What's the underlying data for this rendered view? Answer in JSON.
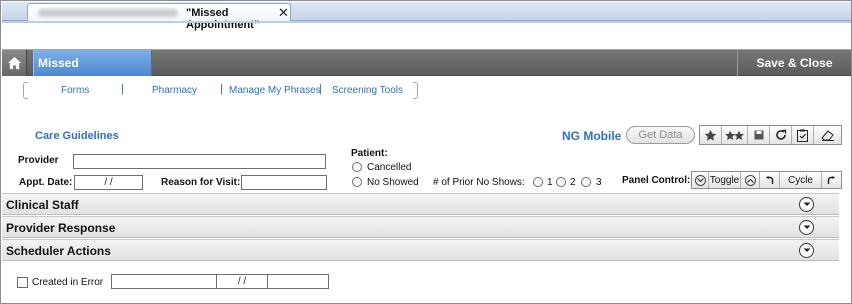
{
  "tab": {
    "title": "\"Missed Appointment\"",
    "close_glyph": "✕"
  },
  "header": {
    "home_icon": "home-icon",
    "form_title": "Missed Appointment",
    "save_close_label": "Save & Close"
  },
  "nav": {
    "links": [
      "Forms",
      "Pharmacy",
      "Manage My Phrases",
      "Screening Tools"
    ],
    "separator": "|"
  },
  "care_guidelines_label": "Care Guidelines",
  "ng_mobile": {
    "label": "NG Mobile",
    "button_label": "Get Data"
  },
  "toolbar_icons": [
    "star-icon",
    "stars-icon",
    "save-icon",
    "refresh-icon",
    "clipboard-check-icon",
    "eraser-icon"
  ],
  "form": {
    "provider_label": "Provider",
    "provider_value": "",
    "appt_date_label": "Appt. Date:",
    "appt_date_value": "/ /",
    "reason_label": "Reason for Visit:",
    "reason_value": "",
    "patient_label": "Patient:",
    "patient_options": [
      "Cancelled",
      "No Showed"
    ],
    "prior_no_shows_label": "# of Prior No Shows:",
    "prior_no_shows_options": [
      "1",
      "2",
      "3"
    ]
  },
  "panel_control": {
    "label": "Panel Control:",
    "toggle_label": "Toggle",
    "cycle_label": "Cycle"
  },
  "sections": [
    "Clinical Staff",
    "Provider Response",
    "Scheduler Actions"
  ],
  "error_row": {
    "label": "Created in Error",
    "date_value": "/ /"
  },
  "colors": {
    "header_gray": "#656565",
    "form_title_blue": "#5a92d6",
    "link_blue": "#2f6fc4"
  }
}
